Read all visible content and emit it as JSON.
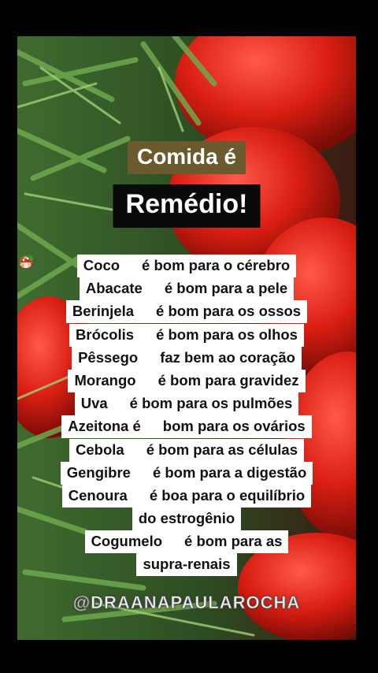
{
  "title": {
    "line1": "Comida é",
    "line2": "Remédio!"
  },
  "lines": [
    {
      "a": "Coco",
      "icon": "coconut-icon",
      "b": "é bom para o cérebro"
    },
    {
      "a": "Abacate",
      "icon": "avocado-icon",
      "b": "é bom para a pele"
    },
    {
      "a": "Berinjela",
      "icon": "eggplant-icon",
      "b": "é bom para os ossos"
    },
    {
      "a": "Brócolis",
      "icon": "broccoli-icon",
      "b": "é bom para os olhos"
    },
    {
      "a": "Pêssego",
      "icon": "peach-icon",
      "b": "faz bem ao coração"
    },
    {
      "a": "Morango",
      "icon": "strawberry-icon",
      "b": "é bom para gravidez"
    },
    {
      "a": "Uva",
      "icon": "grapes-icon",
      "b": "é bom para os pulmões"
    },
    {
      "a": "Azeitona é",
      "icon": "olive-icon",
      "b": "bom para os ovários"
    },
    {
      "a": "Cebola",
      "icon": "onion-icon",
      "b": "é bom para as células"
    },
    {
      "a": "Gengibre",
      "icon": "ginger-icon",
      "b": "é bom para a digestão"
    },
    {
      "a": "Cenoura",
      "icon": "carrot-icon",
      "b": "é boa para o equilíbrio"
    },
    {
      "a": "do estrogênio",
      "icon": "",
      "b": ""
    },
    {
      "a": "Cogumelo",
      "icon": "mushroom-icon",
      "b": "é bom para as"
    },
    {
      "a": "supra-renais",
      "icon": "",
      "b": ""
    }
  ],
  "watermark": "@DRAANAPAULAROCHA",
  "colors": {
    "title1_bg": "#6b5a2e",
    "title2_bg": "#0a0a0a",
    "line_bg": "#ffffff"
  }
}
